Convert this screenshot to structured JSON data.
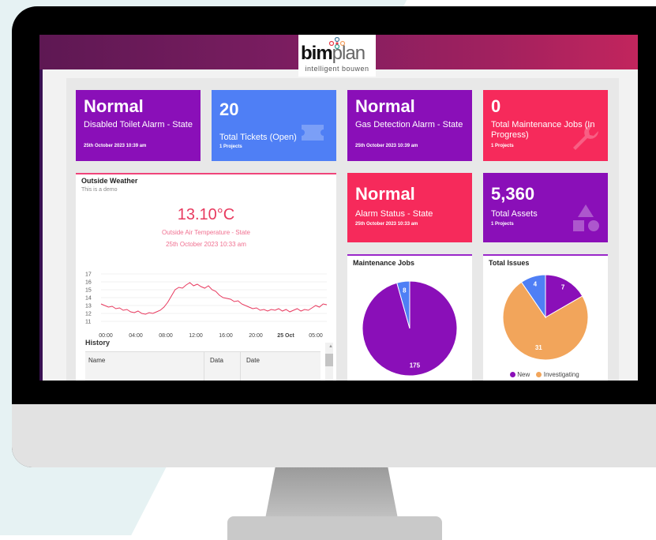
{
  "brand": {
    "name_bold": "bim",
    "name_light": "plan",
    "tagline": "intelligent bouwen",
    "colors": {
      "purple": "#8a0fb8",
      "blue": "#4f7ff5",
      "pink": "#f62a5b",
      "orange": "#f2a55b"
    }
  },
  "tiles": [
    {
      "value": "Normal",
      "label": "Disabled Toilet Alarm - State",
      "sub": "25th October 2023 10:39 am",
      "color": "purple"
    },
    {
      "value": "20",
      "label": "Total Tickets (Open)",
      "sub": "1 Projects",
      "color": "blue",
      "icon": "ticket-icon"
    },
    {
      "value": "Normal",
      "label": "Gas Detection Alarm - State",
      "sub": "25th October 2023 10:39 am",
      "color": "purple"
    },
    {
      "value": "0",
      "label": "Total Maintenance Jobs (In Progress)",
      "sub": "1 Projects",
      "color": "pink",
      "icon": "wrench-icon"
    },
    {
      "value": "Normal",
      "label": "Alarm Status - State",
      "sub": "25th October 2023 10:33 am",
      "color": "pink"
    },
    {
      "value": "5,360",
      "label": "Total Assets",
      "sub": "1 Projects",
      "color": "purple",
      "icon": "shapes-icon"
    }
  ],
  "weather": {
    "title": "Outside Weather",
    "subtitle": "This is a demo",
    "temperature": "13.10°C",
    "metric": "Outside Air Temperature - State",
    "timestamp": "25th October 2023 10:33 am"
  },
  "chart_data": [
    {
      "type": "line",
      "title": "",
      "xlabel": "",
      "ylabel": "",
      "ylim": [
        11,
        17
      ],
      "y_ticks": [
        "17",
        "16",
        "15",
        "14",
        "13",
        "12",
        "11"
      ],
      "x_ticks": [
        "00:00",
        "04:00",
        "08:00",
        "12:00",
        "16:00",
        "20:00",
        "25 Oct",
        "05:00"
      ],
      "grid": true,
      "color": "#e83a5f",
      "series": [
        {
          "values": [
            13.2,
            13.0,
            12.8,
            12.9,
            12.6,
            12.7,
            12.4,
            12.5,
            12.2,
            12.1,
            12.3,
            12.0,
            11.9,
            12.1,
            12.0,
            12.2,
            12.4,
            12.8,
            13.4,
            14.2,
            15.0,
            15.3,
            15.2,
            15.6,
            15.9,
            15.5,
            15.7,
            15.4,
            15.2,
            15.5,
            15.0,
            14.8,
            14.3,
            14.0,
            13.9,
            13.8,
            13.5,
            13.6,
            13.2,
            13.0,
            12.8,
            12.6,
            12.7,
            12.4,
            12.5,
            12.3,
            12.5,
            12.4,
            12.6,
            12.3,
            12.5,
            12.2,
            12.4,
            12.6,
            12.3,
            12.5,
            12.4,
            12.7,
            13.0,
            12.8,
            13.2,
            13.1
          ]
        }
      ]
    },
    {
      "type": "pie",
      "title": "Maintenance Jobs",
      "slices": [
        {
          "label": "",
          "value": 175,
          "color": "#8a0fb8"
        },
        {
          "label": "",
          "value": 8,
          "color": "#4f7ff5"
        }
      ]
    },
    {
      "type": "pie",
      "title": "Total Issues",
      "slices": [
        {
          "label": "Investigating",
          "value": 31,
          "color": "#f2a55b"
        },
        {
          "label": "",
          "value": 4,
          "color": "#4f7ff5"
        },
        {
          "label": "New",
          "value": 7,
          "color": "#8a0fb8"
        }
      ],
      "legend": [
        "New",
        "Investigating"
      ],
      "legend_colors": [
        "#8a0fb8",
        "#f2a55b"
      ]
    }
  ],
  "history": {
    "title": "History",
    "columns": [
      "Name",
      "Data",
      "Date"
    ]
  }
}
